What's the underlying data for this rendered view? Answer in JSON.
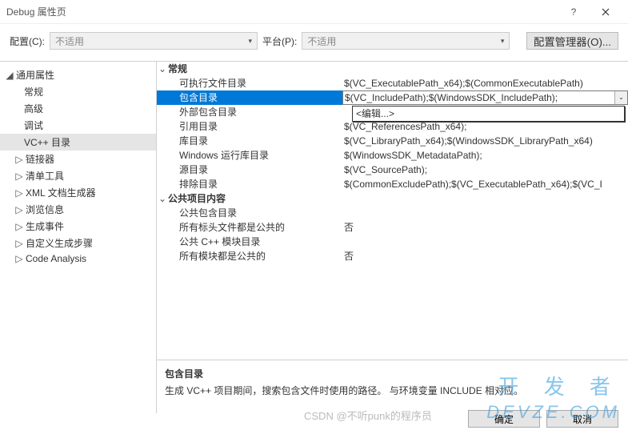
{
  "window": {
    "title": "Debug 属性页"
  },
  "toolbar": {
    "config_label": "配置(C):",
    "config_value": "不适用",
    "platform_label": "平台(P):",
    "platform_value": "不适用",
    "config_manager": "配置管理器(O)..."
  },
  "tree": {
    "root": "通用属性",
    "items": [
      {
        "label": "常规",
        "child": false
      },
      {
        "label": "高级",
        "child": false
      },
      {
        "label": "调试",
        "child": false
      },
      {
        "label": "VC++ 目录",
        "child": false,
        "selected": true
      },
      {
        "label": "链接器",
        "child": true
      },
      {
        "label": "清单工具",
        "child": true
      },
      {
        "label": "XML 文档生成器",
        "child": true
      },
      {
        "label": "浏览信息",
        "child": true
      },
      {
        "label": "生成事件",
        "child": true
      },
      {
        "label": "自定义生成步骤",
        "child": true
      },
      {
        "label": "Code Analysis",
        "child": true
      }
    ]
  },
  "props": {
    "cat1": "常规",
    "rows1": [
      {
        "k": "可执行文件目录",
        "v": "$(VC_ExecutablePath_x64);$(CommonExecutablePath)"
      },
      {
        "k": "包含目录",
        "v": "$(VC_IncludePath);$(WindowsSDK_IncludePath);",
        "sel": true
      },
      {
        "k": "外部包含目录",
        "v": ""
      },
      {
        "k": "引用目录",
        "v": "$(VC_ReferencesPath_x64);"
      },
      {
        "k": "库目录",
        "v": "$(VC_LibraryPath_x64);$(WindowsSDK_LibraryPath_x64)"
      },
      {
        "k": "Windows 运行库目录",
        "v": "$(WindowsSDK_MetadataPath);"
      },
      {
        "k": "源目录",
        "v": "$(VC_SourcePath);"
      },
      {
        "k": "排除目录",
        "v": "$(CommonExcludePath);$(VC_ExecutablePath_x64);$(VC_I"
      }
    ],
    "cat2": "公共项目内容",
    "rows2": [
      {
        "k": "公共包含目录",
        "v": ""
      },
      {
        "k": "所有标头文件都是公共的",
        "v": "否"
      },
      {
        "k": "公共 C++ 模块目录",
        "v": ""
      },
      {
        "k": "所有模块都是公共的",
        "v": "否"
      }
    ],
    "edit_popup": "<编辑...>"
  },
  "desc": {
    "title": "包含目录",
    "body": "生成 VC++ 项目期间，搜索包含文件时使用的路径。    与环境变量 INCLUDE 相对应。"
  },
  "footer": {
    "ok": "确定",
    "cancel": "取消"
  },
  "watermark": {
    "line1": "开 发 者",
    "line2": "DEVZE.COM",
    "csdn": "CSDN @不听punk的程序员"
  }
}
